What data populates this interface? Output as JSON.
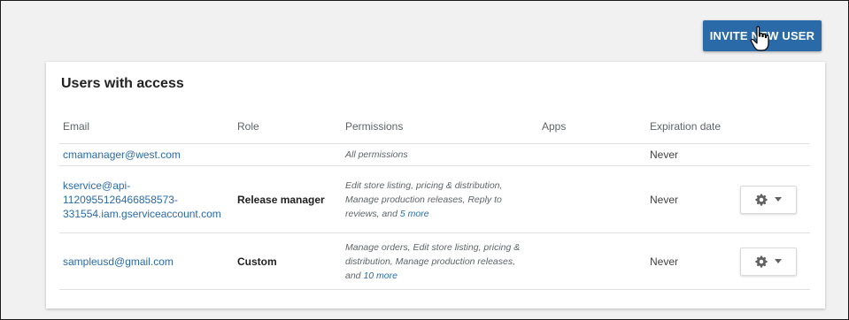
{
  "toolbar": {
    "invite_label": "INVITE NEW USER"
  },
  "card": {
    "title": "Users with access",
    "columns": [
      "Email",
      "Role",
      "Permissions",
      "Apps",
      "Expiration date"
    ],
    "rows": [
      {
        "email_lines": [
          "cmamanager@west.com"
        ],
        "role": "",
        "permissions_lines": [
          "All permissions"
        ],
        "permissions_more": "",
        "apps": "",
        "expiration": "Never",
        "has_actions": false
      },
      {
        "email_lines": [
          "kservice@api-",
          "1120955126466858573-",
          "331554.iam.gserviceaccount.com"
        ],
        "role": "Release manager",
        "permissions_lines": [
          "Edit store listing, pricing & distribution,",
          "Manage production releases, Reply to",
          "reviews, and "
        ],
        "permissions_more": "5 more",
        "apps": "",
        "expiration": "Never",
        "has_actions": true
      },
      {
        "email_lines": [
          "sampleusd@gmail.com"
        ],
        "role": "Custom",
        "permissions_lines": [
          "Manage orders, Edit store listing, pricing &",
          "distribution, Manage production releases,",
          "and "
        ],
        "permissions_more": "10 more",
        "apps": "",
        "expiration": "Never",
        "has_actions": true
      }
    ]
  },
  "icons": {
    "actions_gear": "gear-icon",
    "actions_caret": "chevron-down-icon",
    "cursor": "hand-pointer-icon"
  },
  "colors": {
    "accent": "#2a6aa8",
    "page_background": "#f1f1f1",
    "card_background": "#ffffff"
  }
}
